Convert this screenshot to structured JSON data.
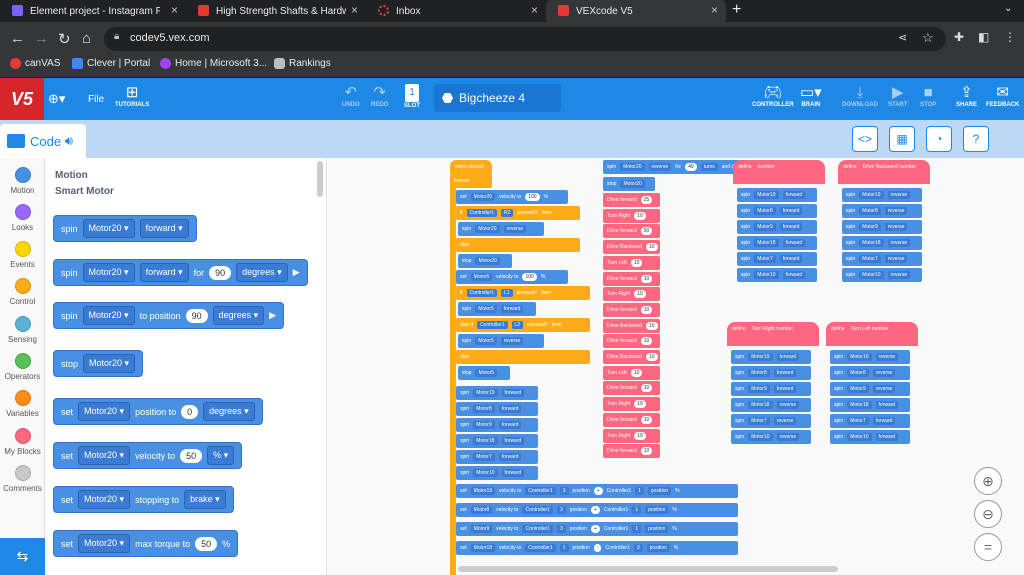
{
  "browser": {
    "tabs": [
      {
        "title": "Element project - Instagram Po",
        "color": "#7b61ff"
      },
      {
        "title": "High Strength Shafts & Hardwa",
        "color": "#e53935"
      },
      {
        "title": "Inbox",
        "color": "#ea4335"
      },
      {
        "title": "VEXcode V5",
        "color": "#e53935"
      }
    ],
    "url": "codev5.vex.com",
    "bookmarks": [
      "canVAS",
      "Clever | Portal",
      "Home | Microsoft 3...",
      "Rankings"
    ]
  },
  "vex": {
    "logo": "V5",
    "file_label": "File",
    "tutorials_label": "TUTORIALS",
    "undo": "UNDO",
    "redo": "REDO",
    "slot_label": "SLOT",
    "slot_num": "1",
    "project_name": "Bigcheeze 4",
    "controller": "CONTROLLER",
    "brain": "BRAIN",
    "download": "DOWNLOAD",
    "start": "START",
    "stop": "STOP",
    "share": "SHARE",
    "feedback": "FEEDBACK"
  },
  "code_tab": "Code",
  "categories": [
    {
      "label": "Motion",
      "color": "#4a90e2"
    },
    {
      "label": "Looks",
      "color": "#9966ff"
    },
    {
      "label": "Events",
      "color": "#ffd500"
    },
    {
      "label": "Control",
      "color": "#ffab19"
    },
    {
      "label": "Sensing",
      "color": "#5cb1d6"
    },
    {
      "label": "Operators",
      "color": "#59c059"
    },
    {
      "label": "Variables",
      "color": "#ff8c1a"
    },
    {
      "label": "My Blocks",
      "color": "#ff6680"
    },
    {
      "label": "Comments",
      "color": "#c8c8c8"
    }
  ],
  "flyout": {
    "heading": "Motion",
    "subheading": "Smart Motor",
    "blocks": {
      "b1": {
        "t1": "spin",
        "m": "Motor20",
        "d": "forward"
      },
      "b2": {
        "t1": "spin",
        "m": "Motor20",
        "d": "forward",
        "t2": "for",
        "n": "90",
        "u": "degrees"
      },
      "b3": {
        "t1": "spin",
        "m": "Motor20",
        "t2": "to position",
        "n": "90",
        "u": "degrees"
      },
      "b4": {
        "t1": "stop",
        "m": "Motor20"
      },
      "b5": {
        "t1": "set",
        "m": "Motor20",
        "t2": "position to",
        "n": "0",
        "u": "degrees"
      },
      "b6": {
        "t1": "set",
        "m": "Motor20",
        "t2": "velocity to",
        "n": "50",
        "u": "%"
      },
      "b7": {
        "t1": "set",
        "m": "Motor20",
        "t2": "stopping to",
        "u": "brake"
      },
      "b8": {
        "t1": "set",
        "m": "Motor20",
        "t2": "max torque to",
        "n": "50",
        "u": "%"
      }
    }
  },
  "canvas": {
    "main": {
      "hat": "when started",
      "forever": "forever",
      "rows": [
        [
          "set",
          "Motor20",
          "velocity to",
          "100",
          "%"
        ],
        [
          "if",
          "Controller1",
          "R2",
          "pressed?",
          "then"
        ],
        [
          "spin",
          "Motor20",
          "reverse"
        ],
        [
          "else"
        ],
        [
          "stop",
          "Motor20"
        ],
        [
          "set",
          "Motor5",
          "velocity to",
          "100",
          "%"
        ],
        [
          "if",
          "Controller1",
          "L1",
          "pressed?",
          "then"
        ],
        [
          "spin",
          "Motor5",
          "forward"
        ],
        [
          "else if",
          "Controller1",
          "L2",
          "pressed?",
          "then"
        ],
        [
          "spin",
          "Motor5",
          "reverse"
        ],
        [
          "else"
        ],
        [
          "stop",
          "Motor5"
        ]
      ],
      "drive": [
        [
          "spin",
          "Motor19",
          "forward"
        ],
        [
          "spin",
          "Motor8",
          "forward"
        ],
        [
          "spin",
          "Motor9",
          "forward"
        ],
        [
          "spin",
          "Motor18",
          "forward"
        ],
        [
          "spin",
          "Motor7",
          "forward"
        ],
        [
          "spin",
          "Motor10",
          "forward"
        ]
      ],
      "vel": [
        [
          "set",
          "Motor19",
          "velocity to",
          "Controller1",
          "3",
          "position",
          "+",
          "Controller1",
          "1",
          "position",
          "%"
        ],
        [
          "set",
          "Motor8",
          "velocity to",
          "Controller1",
          "3",
          "position",
          "+",
          "Controller1",
          "1",
          "position",
          "%"
        ],
        [
          "set",
          "Motor9",
          "velocity to",
          "Controller1",
          "3",
          "position",
          "+",
          "Controller1",
          "1",
          "position",
          "%"
        ],
        [
          "set",
          "Motor18",
          "velocity to",
          "Controller1",
          "1",
          "position",
          "-",
          "Controller1",
          "3",
          "position",
          "%"
        ]
      ]
    },
    "auton": {
      "top": [
        "spin",
        "Motor20",
        "reverse",
        "for",
        "49",
        "turns",
        "and don't wait"
      ],
      "stop": [
        "stop",
        "Motor20"
      ],
      "seq": [
        [
          "Drive forward",
          "25"
        ],
        [
          "Turn Right",
          "10"
        ],
        [
          "Drive forward",
          "50"
        ],
        [
          "Drive Backward",
          "10"
        ],
        [
          "Turn Left",
          "10"
        ],
        [
          "Drive forward",
          "10"
        ],
        [
          "Turn Right",
          "10"
        ],
        [
          "Drive forward",
          "10"
        ],
        [
          "Drive Backward",
          "10"
        ],
        [
          "Drive forward",
          "10"
        ],
        [
          "Drive Backward",
          "10"
        ],
        [
          "Turn Left",
          "10"
        ],
        [
          "Drive forward",
          "10"
        ],
        [
          "Turn Right",
          "10"
        ],
        [
          "Drive forward",
          "10"
        ],
        [
          "Turn Right",
          "10"
        ],
        [
          "Drive forward",
          "10"
        ]
      ]
    },
    "defs": [
      {
        "define": "define",
        "name": "",
        "param": "number",
        "dirs": [
          "forward",
          "forward",
          "forward",
          "forward",
          "forward",
          "forward"
        ]
      },
      {
        "define": "define",
        "name": "Drive Backward",
        "param": "number",
        "dirs": [
          "reverse",
          "reverse",
          "reverse",
          "reverse",
          "reverse",
          "reverse"
        ]
      },
      {
        "define": "define",
        "name": "Turn Right",
        "param": "number",
        "dirs": [
          "forward",
          "forward",
          "forward",
          "reverse",
          "reverse",
          "reverse"
        ]
      },
      {
        "define": "define",
        "name": "Turn Left",
        "param": "number",
        "dirs": [
          "reverse",
          "reverse",
          "reverse",
          "forward",
          "forward",
          "forward"
        ]
      }
    ],
    "motors": [
      "Motor19",
      "Motor8",
      "Motor9",
      "Motor18",
      "Motor7",
      "Motor10"
    ]
  }
}
